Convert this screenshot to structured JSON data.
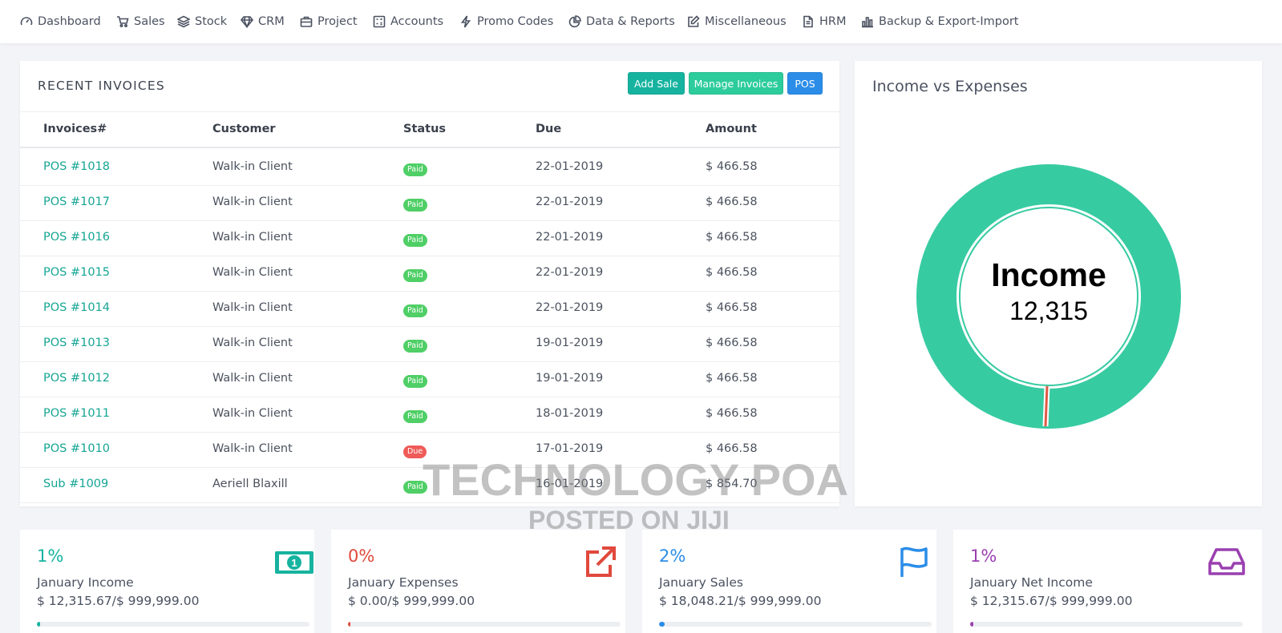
{
  "nav": {
    "items": [
      {
        "label": "Dashboard",
        "icon": "dashboard-gauge-icon"
      },
      {
        "label": "Sales",
        "icon": "cart-icon"
      },
      {
        "label": "Stock",
        "icon": "layers-icon"
      },
      {
        "label": "CRM",
        "icon": "diamond-icon"
      },
      {
        "label": "Project",
        "icon": "briefcase-icon"
      },
      {
        "label": "Accounts",
        "icon": "calculator-icon"
      },
      {
        "label": "Promo Codes",
        "icon": "bolt-icon"
      },
      {
        "label": "Data & Reports",
        "icon": "pie-icon"
      },
      {
        "label": "Miscellaneous",
        "icon": "edit-icon"
      },
      {
        "label": "HRM",
        "icon": "file-icon"
      },
      {
        "label": "Backup & Export-Import",
        "icon": "bar-chart-icon"
      }
    ]
  },
  "invoices": {
    "title": "RECENT INVOICES",
    "buttons": {
      "add_sale": "Add Sale",
      "manage": "Manage Invoices",
      "pos": "POS"
    },
    "headers": [
      "Invoices#",
      "Customer",
      "Status",
      "Due",
      "Amount"
    ],
    "rows": [
      {
        "id": "POS #1018",
        "customer": "Walk-in Client",
        "status": "Paid",
        "due": "22-01-2019",
        "amount": "$ 466.58"
      },
      {
        "id": "POS #1017",
        "customer": "Walk-in Client",
        "status": "Paid",
        "due": "22-01-2019",
        "amount": "$ 466.58"
      },
      {
        "id": "POS #1016",
        "customer": "Walk-in Client",
        "status": "Paid",
        "due": "22-01-2019",
        "amount": "$ 466.58"
      },
      {
        "id": "POS #1015",
        "customer": "Walk-in Client",
        "status": "Paid",
        "due": "22-01-2019",
        "amount": "$ 466.58"
      },
      {
        "id": "POS #1014",
        "customer": "Walk-in Client",
        "status": "Paid",
        "due": "22-01-2019",
        "amount": "$ 466.58"
      },
      {
        "id": "POS #1013",
        "customer": "Walk-in Client",
        "status": "Paid",
        "due": "19-01-2019",
        "amount": "$ 466.58"
      },
      {
        "id": "POS #1012",
        "customer": "Walk-in Client",
        "status": "Paid",
        "due": "19-01-2019",
        "amount": "$ 466.58"
      },
      {
        "id": "POS #1011",
        "customer": "Walk-in Client",
        "status": "Paid",
        "due": "18-01-2019",
        "amount": "$ 466.58"
      },
      {
        "id": "POS #1010",
        "customer": "Walk-in Client",
        "status": "Due",
        "due": "17-01-2019",
        "amount": "$ 466.58"
      },
      {
        "id": "Sub #1009",
        "customer": "Aeriell Blaxill",
        "status": "Paid",
        "due": "16-01-2019",
        "amount": "$ 854.70"
      }
    ]
  },
  "chart": {
    "title": "Income vs Expenses",
    "center_label": "Income",
    "center_value": "12,315"
  },
  "chart_data": {
    "type": "pie",
    "title": "Income vs Expenses",
    "categories": [
      "Income",
      "Expenses"
    ],
    "values": [
      12315.67,
      0
    ],
    "colors": [
      "#37cba2",
      "#e05a45"
    ]
  },
  "stats": [
    {
      "pct": "1%",
      "label": "January Income",
      "value": "$ 12,315.67/$ 999,999.00",
      "progress": 0.01,
      "color": "#16b39f",
      "icon": "money-icon"
    },
    {
      "pct": "0%",
      "label": "January Expenses",
      "value": "$ 0.00/$ 999,999.00",
      "progress": 0.0,
      "color": "#e0493c",
      "icon": "external-link-icon"
    },
    {
      "pct": "2%",
      "label": "January Sales",
      "value": "$ 18,048.21/$ 999,999.00",
      "progress": 0.02,
      "color": "#2b8de8",
      "icon": "flag-icon"
    },
    {
      "pct": "1%",
      "label": "January Net Income",
      "value": "$ 12,315.67/$ 999,999.00",
      "progress": 0.01,
      "color": "#9a3fb0",
      "icon": "inbox-icon"
    }
  ],
  "watermark": {
    "line1": "TECHNOLOGY POA",
    "line2": "POSTED ON JIJI"
  }
}
